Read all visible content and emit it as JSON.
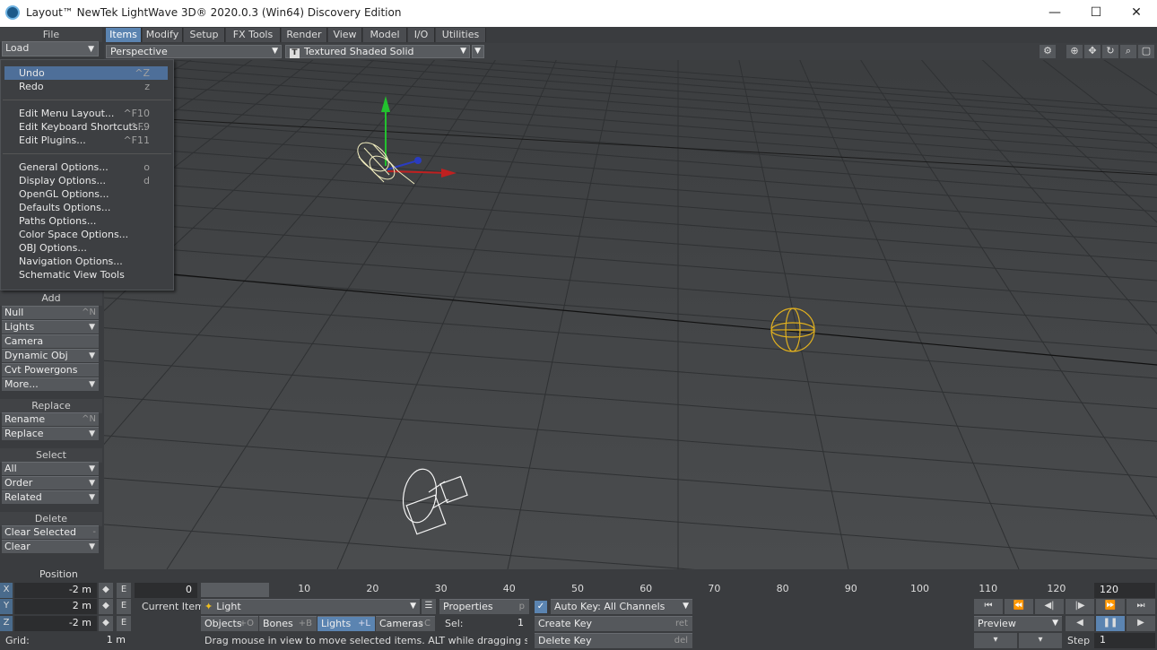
{
  "window": {
    "title": "Layout™ NewTek LightWave 3D® 2020.0.3 (Win64) Discovery Edition",
    "min": "—",
    "max": "☐",
    "close": "✕"
  },
  "file": {
    "header": "File",
    "load": "Load"
  },
  "menu": {
    "items": [
      {
        "label": "Undo",
        "shortcut": "^Z",
        "selected": true
      },
      {
        "label": "Redo",
        "shortcut": "z"
      },
      {
        "label": "Edit Menu Layout...",
        "shortcut": "^F10"
      },
      {
        "label": "Edit Keyboard Shortcuts...",
        "shortcut": "^F9"
      },
      {
        "label": "Edit Plugins...",
        "shortcut": "^F11"
      },
      {
        "label": "General Options...",
        "shortcut": "o"
      },
      {
        "label": "Display Options...",
        "shortcut": "d"
      },
      {
        "label": "OpenGL Options...",
        "shortcut": ""
      },
      {
        "label": "Defaults Options...",
        "shortcut": ""
      },
      {
        "label": "Paths Options...",
        "shortcut": ""
      },
      {
        "label": "Color Space Options...",
        "shortcut": ""
      },
      {
        "label": "OBJ Options...",
        "shortcut": ""
      },
      {
        "label": "Navigation Options...",
        "shortcut": ""
      },
      {
        "label": "Schematic View Tools",
        "shortcut": ""
      }
    ]
  },
  "tabs": [
    "Items",
    "Modify",
    "Setup",
    "FX Tools",
    "Render",
    "View",
    "Model",
    "I/O",
    "Utilities"
  ],
  "viewport": {
    "view": "Perspective",
    "shading": "Textured Shaded Solid",
    "shading_icon": "T"
  },
  "panel": {
    "add": {
      "header": "Add",
      "items": [
        {
          "label": "Null",
          "sc": "^N"
        },
        {
          "label": "Lights",
          "dd": "⌄"
        },
        {
          "label": "Camera"
        },
        {
          "label": "Dynamic Obj",
          "dd": "⌄"
        },
        {
          "label": "Cvt Powergons"
        },
        {
          "label": "More...",
          "dd": "⌄"
        }
      ]
    },
    "replace": {
      "header": "Replace",
      "items": [
        {
          "label": "Rename",
          "sc": "^N"
        },
        {
          "label": "Replace",
          "dd": "⌄"
        }
      ]
    },
    "select": {
      "header": "Select",
      "items": [
        {
          "label": "All",
          "dd": "⌄"
        },
        {
          "label": "Order",
          "dd": "⌄"
        },
        {
          "label": "Related",
          "dd": "⌄"
        }
      ]
    },
    "delete": {
      "header": "Delete",
      "items": [
        {
          "label": "Clear Selected",
          "sc": "-"
        },
        {
          "label": "Clear",
          "dd": "⌄"
        }
      ]
    }
  },
  "bottom": {
    "position": "Position",
    "x_label": "X",
    "x_val": "-2 m",
    "y_label": "Y",
    "y_val": "2 m",
    "z_label": "Z",
    "z_val": "-2 m",
    "e": "E",
    "grid_label": "Grid:",
    "grid_val": "1 m",
    "frame_val": "0",
    "current_item_label": "Current Item",
    "current_item": "Light",
    "properties": "Properties",
    "properties_sc": "p",
    "autokey": "Auto Key: All Channels",
    "objects": "Objects",
    "objects_sc": "+O",
    "bones": "Bones",
    "bones_sc": "+B",
    "lights": "Lights",
    "lights_sc": "+L",
    "cameras": "Cameras",
    "cameras_sc": "+C",
    "sel_label": "Sel:",
    "sel_val": "1",
    "create_key": "Create Key",
    "create_key_sc": "ret",
    "delete_key": "Delete Key",
    "delete_key_sc": "del",
    "status": "Drag mouse in view to move selected items. ALT while dragging snaps to i...",
    "preview": "Preview",
    "step_label": "Step",
    "step_val": "1",
    "end_frame": "120",
    "ticks": [
      "0",
      "10",
      "20",
      "30",
      "40",
      "50",
      "60",
      "70",
      "80",
      "90",
      "100",
      "110",
      "120"
    ]
  }
}
